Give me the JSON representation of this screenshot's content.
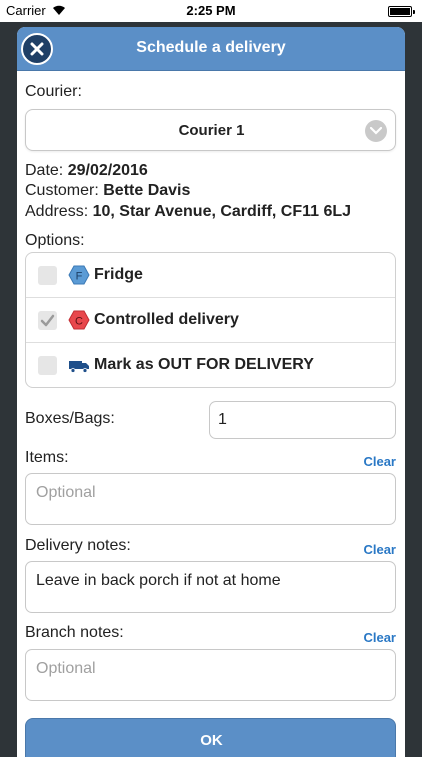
{
  "status_bar": {
    "carrier": "Carrier",
    "time": "2:25 PM"
  },
  "dialog": {
    "title": "Schedule a delivery"
  },
  "courier": {
    "label": "Courier:",
    "selected": "Courier 1"
  },
  "details": {
    "date_label": "Date:",
    "date_value": "29/02/2016",
    "customer_label": "Customer:",
    "customer_value": "Bette Davis",
    "address_label": "Address:",
    "address_value": "10, Star Avenue, Cardiff, CF11 6LJ"
  },
  "options": {
    "label": "Options:",
    "items": [
      {
        "label": "Fridge",
        "badge": "F",
        "checked": false,
        "icon": "fridge-hexagon-icon"
      },
      {
        "label": "Controlled delivery",
        "badge": "C",
        "checked": true,
        "icon": "controlled-hexagon-icon"
      },
      {
        "label": "Mark as OUT FOR DELIVERY",
        "checked": false,
        "icon": "van-icon"
      }
    ]
  },
  "boxes": {
    "label": "Boxes/Bags:",
    "value": "1"
  },
  "items": {
    "label": "Items:",
    "placeholder": "Optional",
    "clear": "Clear"
  },
  "delivery_notes": {
    "label": "Delivery notes:",
    "value": "Leave in back porch if not at home",
    "clear": "Clear"
  },
  "branch_notes": {
    "label": "Branch notes:",
    "placeholder": "Optional",
    "clear": "Clear"
  },
  "ok_label": "OK",
  "colors": {
    "accent": "#5b8fc7",
    "link": "#2a78c5",
    "fridge": "#5b9bd5",
    "controlled": "#e8474c"
  }
}
